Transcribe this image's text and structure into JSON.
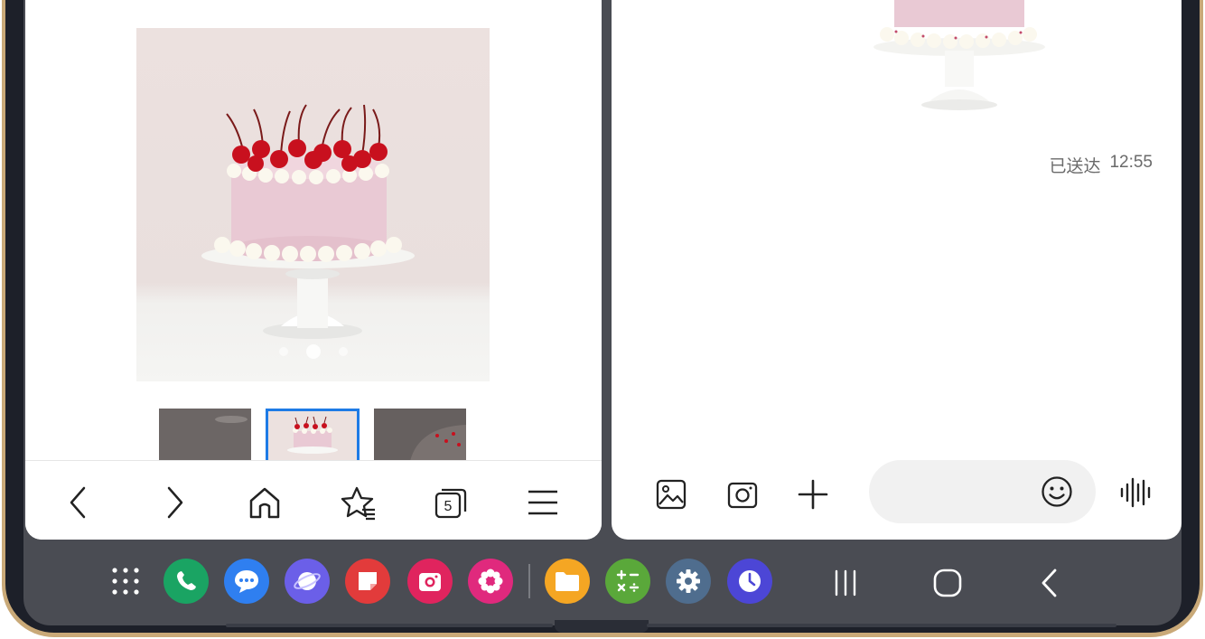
{
  "message_thread": {
    "delivery_status": "已送达",
    "delivery_time": "12:55"
  },
  "message_input": {
    "placeholder": ""
  },
  "carousel": {
    "count": 3,
    "active_index": 1
  },
  "colors": {
    "accent_blue": "#1e7be6",
    "frame_gold": "#c9a978",
    "dock_background": "#4a4c53",
    "phone_green": "#1aa463",
    "messages_blue": "#2f7ff0",
    "internet_purple": "#6b5fe8",
    "notes_red": "#e23b3b",
    "camera_pink": "#e0245e",
    "bixby_magenta": "#e0297d",
    "files_orange": "#f5a623",
    "calculator_green": "#5aa83a",
    "settings_slate": "#4f6d8e",
    "clock_indigo": "#4c46d6"
  },
  "browser_toolbar": {
    "tab_count": "5",
    "icons": [
      "back-icon",
      "forward-icon",
      "home-icon",
      "bookmark-icon",
      "tabs-icon",
      "menu-icon"
    ]
  },
  "chat_toolbar": {
    "icons": [
      "gallery-icon",
      "camera-icon",
      "plus-icon",
      "emoji-icon",
      "voice-icon"
    ]
  },
  "dock": {
    "apps": [
      "app-drawer-icon",
      "phone-icon",
      "messages-icon",
      "internet-icon",
      "notes-icon",
      "camera-icon",
      "bixby-icon",
      "files-icon",
      "calculator-icon",
      "settings-icon",
      "clock-icon"
    ],
    "system": [
      "recents-icon",
      "home-icon",
      "back-icon"
    ]
  }
}
